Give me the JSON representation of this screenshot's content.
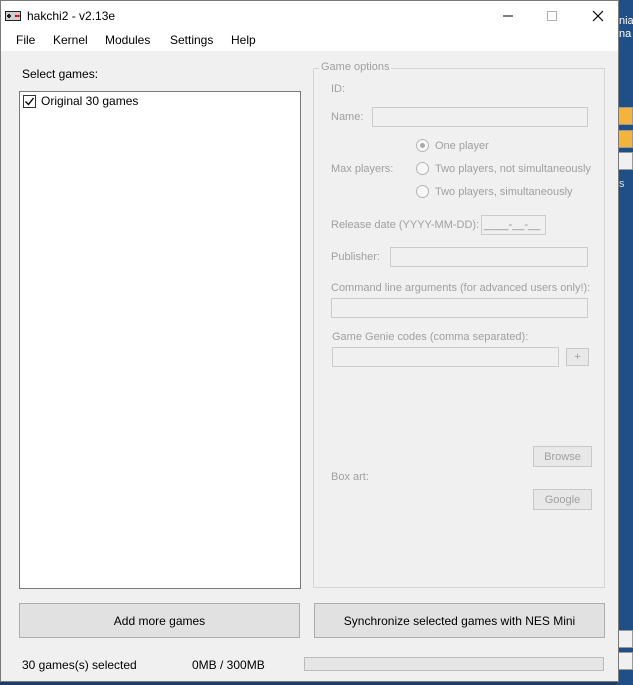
{
  "window": {
    "title": "hakchi2 - v2.13e"
  },
  "menu": [
    "File",
    "Kernel",
    "Modules",
    "Settings",
    "Help"
  ],
  "games_panel": {
    "label": "Select games:",
    "items": [
      {
        "label": "Original 30 games",
        "checked": true
      }
    ]
  },
  "game_options": {
    "title": "Game options",
    "id_label": "ID:",
    "name_label": "Name:",
    "name_value": "",
    "max_players_label": "Max players:",
    "player_options": [
      "One player",
      "Two players, not simultaneously",
      "Two players, simultaneously"
    ],
    "selected_player_option": "One player",
    "release_label": "Release date (YYYY-MM-DD):",
    "release_placeholder": "____-__-__",
    "publisher_label": "Publisher:",
    "publisher_value": "",
    "cmdline_label": "Command line arguments (for advanced users only!):",
    "cmdline_value": "",
    "genie_label": "Game Genie codes (comma separated):",
    "genie_value": "",
    "genie_add": "+",
    "browse_label": "Browse",
    "boxart_label": "Box art:",
    "google_label": "Google"
  },
  "buttons": {
    "add_games": "Add more games",
    "sync": "Synchronize selected games with NES Mini"
  },
  "status": {
    "selected": "30 games(s) selected",
    "size": "0MB / 300MB",
    "progress": 0
  },
  "desktop": {
    "right_text_1": "nia",
    "right_text_2": "na",
    "right_text_3": "s"
  }
}
